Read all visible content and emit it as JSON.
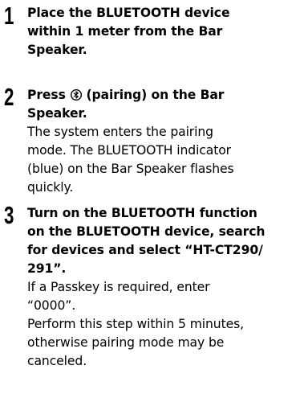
{
  "steps": [
    {
      "number": "1",
      "title_lines": [
        "Place the BLUETOOTH device",
        "within 1 meter from the Bar",
        "Speaker."
      ]
    },
    {
      "number": "2",
      "title_prefix": "Press",
      "icon": "bluetooth-icon",
      "title_suffix": "(pairing) on the Bar",
      "title_line2": "Speaker.",
      "body_lines": [
        "The system enters the pairing",
        "mode. The BLUETOOTH indicator",
        "(blue) on the Bar Speaker flashes",
        "quickly."
      ]
    },
    {
      "number": "3",
      "title_lines": [
        "Turn on the BLUETOOTH function",
        "on the BLUETOOTH device, search",
        "for devices and select “HT-CT290/",
        "291”."
      ],
      "body_lines": [
        "If a Passkey is required, enter",
        "“0000”.",
        "Perform this step within 5 minutes,",
        "otherwise pairing mode may be",
        "canceled."
      ]
    }
  ]
}
